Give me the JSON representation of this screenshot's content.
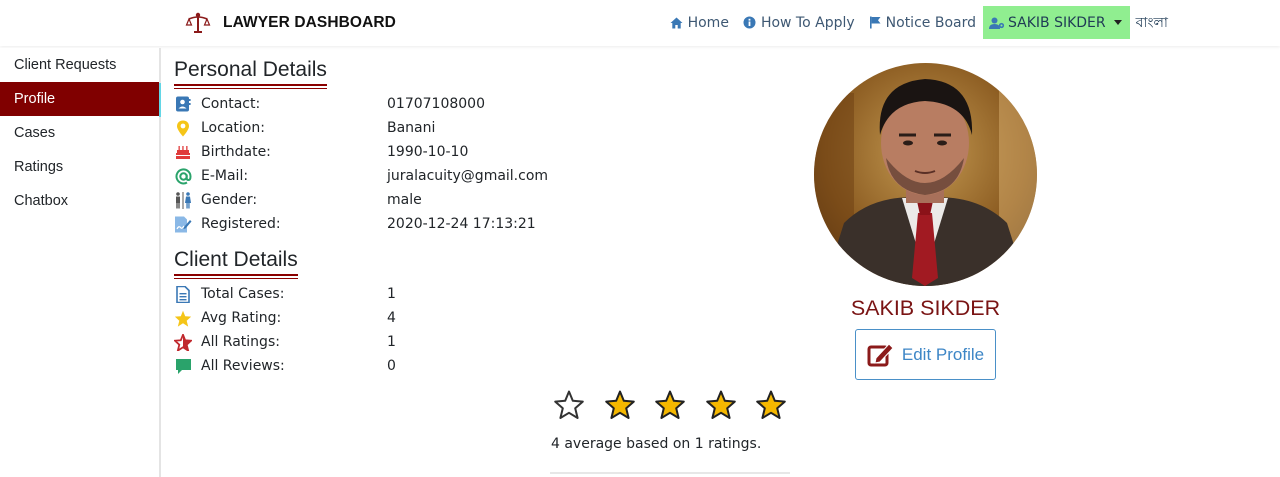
{
  "brand": {
    "title": "LAWYER DASHBOARD"
  },
  "nav": {
    "home": "Home",
    "how_to_apply": "How To Apply",
    "notice_board": "Notice Board",
    "user": "SAKIB SIKDER",
    "language": "বাংলা"
  },
  "sidebar": {
    "items": [
      {
        "label": "Client Requests",
        "active": false
      },
      {
        "label": "Profile",
        "active": true
      },
      {
        "label": "Cases",
        "active": false
      },
      {
        "label": "Ratings",
        "active": false
      },
      {
        "label": "Chatbox",
        "active": false
      }
    ]
  },
  "personal": {
    "title": "Personal Details",
    "rows": [
      {
        "icon": "contact-icon",
        "label": "Contact:",
        "value": "01707108000"
      },
      {
        "icon": "location-icon",
        "label": "Location:",
        "value": "Banani"
      },
      {
        "icon": "birthday-cake-icon",
        "label": "Birthdate:",
        "value": "1990-10-10"
      },
      {
        "icon": "email-at-icon",
        "label": "E-Mail:",
        "value": "juralacuity@gmail.com"
      },
      {
        "icon": "gender-icon",
        "label": "Gender:",
        "value": "male"
      },
      {
        "icon": "registered-icon",
        "label": "Registered:",
        "value": "2020-12-24 17:13:21"
      }
    ]
  },
  "client": {
    "title": "Client Details",
    "rows": [
      {
        "icon": "document-icon",
        "label": "Total Cases:",
        "value": "1"
      },
      {
        "icon": "star-icon",
        "label": "Avg Rating:",
        "value": "4"
      },
      {
        "icon": "star-outline-icon",
        "label": "All Ratings:",
        "value": "1"
      },
      {
        "icon": "chat-bubble-icon",
        "label": "All Reviews:",
        "value": "0"
      }
    ]
  },
  "profile": {
    "name": "SAKIB SIKDER",
    "edit_label": "Edit Profile"
  },
  "rating": {
    "stars_total": 5,
    "stars_filled": 4,
    "summary": "4 average based on 1 ratings."
  },
  "colors": {
    "accent": "#800000",
    "user_button": "#90ee90",
    "star": "#f5b800",
    "link": "#3d86c6"
  }
}
